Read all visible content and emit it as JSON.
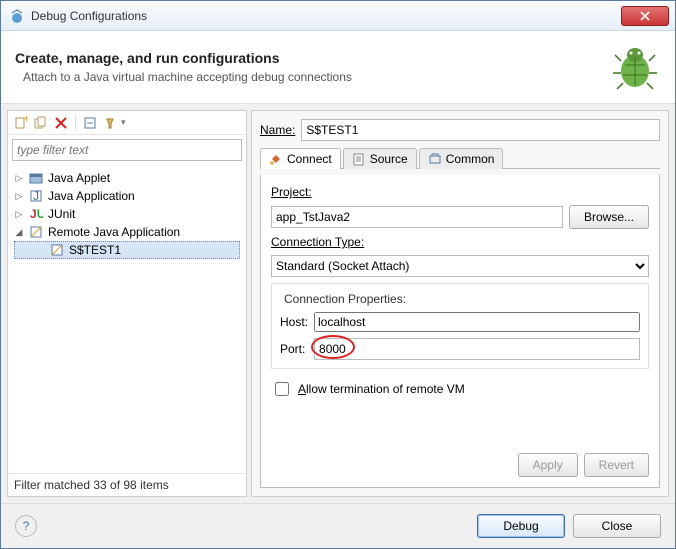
{
  "title": "Debug Configurations",
  "header": {
    "title": "Create, manage, and run configurations",
    "subtitle": "Attach to a Java virtual machine accepting debug connections"
  },
  "filter": {
    "placeholder": "type filter text"
  },
  "tree": {
    "items": [
      {
        "label": "Java Applet"
      },
      {
        "label": "Java Application"
      },
      {
        "label": "JUnit"
      },
      {
        "label": "Remote Java Application",
        "expanded": true
      }
    ],
    "selected_child": "S$TEST1"
  },
  "filter_status": "Filter matched 33 of 98 items",
  "name_label": "Name:",
  "name_value": "S$TEST1",
  "tabs": {
    "connect": "Connect",
    "source": "Source",
    "common": "Common"
  },
  "panel": {
    "project_label": "Project:",
    "project_value": "app_TstJava2",
    "browse": "Browse...",
    "conn_type_label": "Connection Type:",
    "conn_type_value": "Standard (Socket Attach)",
    "conn_props_label": "Connection Properties:",
    "host_label": "Host:",
    "host_value": "localhost",
    "port_label": "Port:",
    "port_value": "8000",
    "allow_term": "Allow termination of remote VM",
    "apply": "Apply",
    "revert": "Revert"
  },
  "footer": {
    "debug": "Debug",
    "close": "Close"
  }
}
